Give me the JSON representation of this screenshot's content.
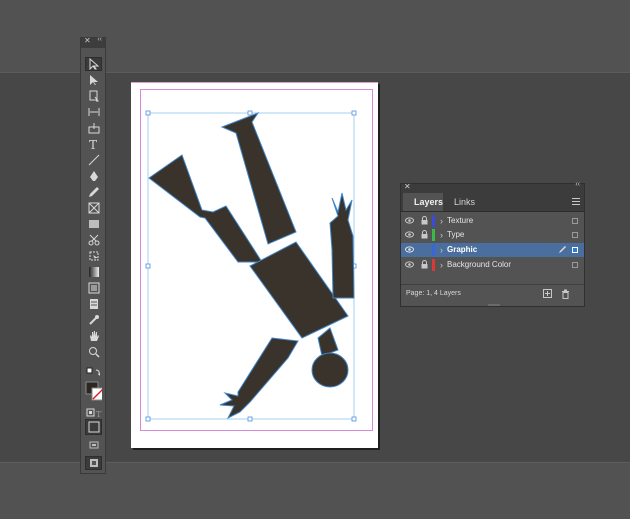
{
  "layers_panel": {
    "tabs": [
      "Layers",
      "Links"
    ],
    "layers": [
      {
        "name": "Texture",
        "color": "#3a4bd8",
        "locked": true,
        "selected": false
      },
      {
        "name": "Type",
        "color": "#3bb84a",
        "locked": true,
        "selected": false
      },
      {
        "name": "Graphic",
        "color": "#3a66d8",
        "locked": false,
        "selected": true
      },
      {
        "name": "Background Color",
        "color": "#d83a3a",
        "locked": true,
        "selected": false
      }
    ],
    "status": "Page: 1, 4 Layers"
  },
  "tools": [
    "selection-tool",
    "direct-selection-tool",
    "page-tool",
    "gap-tool",
    "content-collector-tool",
    "type-tool",
    "line-tool",
    "pen-tool",
    "pencil-tool",
    "rectangle-frame-tool",
    "rectangle-tool",
    "scissors-tool",
    "free-transform-tool",
    "gradient-swatch-tool",
    "gradient-feather-tool",
    "note-tool",
    "eyedropper-tool",
    "hand-tool",
    "zoom-tool"
  ],
  "colors": {
    "workspace": "#474747",
    "panel": "#535353",
    "selection": "#4a6f9e",
    "figure": "#3a332c"
  }
}
